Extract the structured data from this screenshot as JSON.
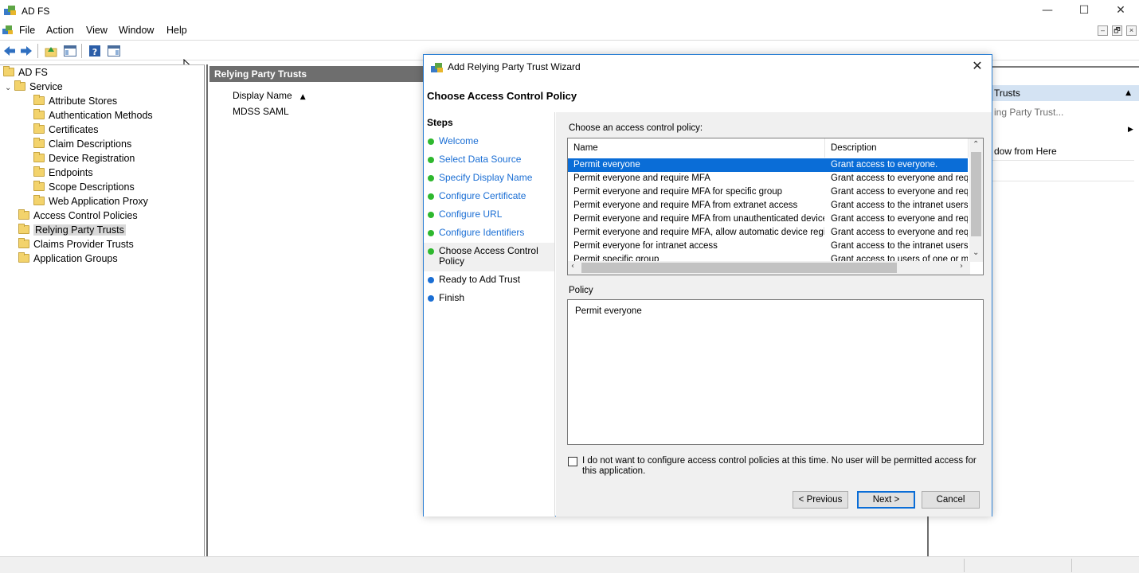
{
  "window": {
    "title": "AD FS",
    "controls": {
      "minimize": "—",
      "maximize": "☐",
      "close": "✕"
    }
  },
  "menubar": {
    "items": [
      "File",
      "Action",
      "View",
      "Window",
      "Help"
    ],
    "mdi": {
      "minimize": "–",
      "restore": "🗗",
      "close": "×"
    }
  },
  "tree": {
    "root": "AD FS",
    "service": "Service",
    "service_children": [
      "Attribute Stores",
      "Authentication Methods",
      "Certificates",
      "Claim Descriptions",
      "Device Registration",
      "Endpoints",
      "Scope Descriptions",
      "Web Application Proxy"
    ],
    "top_items": [
      "Access Control Policies",
      "Relying Party Trusts",
      "Claims Provider Trusts",
      "Application Groups"
    ],
    "selected": "Relying Party Trusts"
  },
  "center": {
    "header": "Relying Party Trusts",
    "column": "Display Name",
    "sort_indicator": "▲",
    "rows": [
      "MDSS SAML"
    ]
  },
  "actions": {
    "header": "Trusts",
    "collapse": "▲",
    "items": [
      "ing Party Trust...",
      "dow from Here"
    ],
    "submenu_arrow": "▶"
  },
  "wizard": {
    "title": "Add Relying Party Trust Wizard",
    "close": "✕",
    "heading": "Choose Access Control Policy",
    "steps_label": "Steps",
    "steps": [
      {
        "label": "Welcome",
        "state": "done"
      },
      {
        "label": "Select Data Source",
        "state": "done"
      },
      {
        "label": "Specify Display Name",
        "state": "done"
      },
      {
        "label": "Configure Certificate",
        "state": "done"
      },
      {
        "label": "Configure URL",
        "state": "done"
      },
      {
        "label": "Configure Identifiers",
        "state": "done"
      },
      {
        "label": "Choose Access Control Policy",
        "state": "current"
      },
      {
        "label": "Ready to Add Trust",
        "state": "pending"
      },
      {
        "label": "Finish",
        "state": "pending"
      }
    ],
    "prompt": "Choose an access control policy:",
    "list_headers": {
      "name": "Name",
      "description": "Description"
    },
    "policies": [
      {
        "name": "Permit everyone",
        "description": "Grant access to everyone."
      },
      {
        "name": "Permit everyone and require MFA",
        "description": "Grant access to everyone and requir"
      },
      {
        "name": "Permit everyone and require MFA for specific group",
        "description": "Grant access to everyone and requir"
      },
      {
        "name": "Permit everyone and require MFA from extranet access",
        "description": "Grant access to the intranet users ar"
      },
      {
        "name": "Permit everyone and require MFA from unauthenticated devices",
        "description": "Grant access to everyone and requir"
      },
      {
        "name": "Permit everyone and require MFA, allow automatic device registr...",
        "description": "Grant access to everyone and requir"
      },
      {
        "name": "Permit everyone for intranet access",
        "description": "Grant access to the intranet users."
      },
      {
        "name": "Permit specific group",
        "description": "Grant access to users of one or more"
      }
    ],
    "selected_policy": "Permit everyone",
    "policy_label": "Policy",
    "policy_text": "Permit everyone",
    "optout_label": "I do not want to configure access control policies at this time. No user will be permitted access for this application.",
    "optout_checked": false,
    "buttons": {
      "previous": "< Previous",
      "next": "Next >",
      "cancel": "Cancel"
    }
  },
  "colors": {
    "selection": "#0a6dd7",
    "step_done_dot": "#2eb82e",
    "step_pending_dot": "#1a6ed4",
    "link_blue": "#1a6ed4",
    "pane_header": "#6e6e6e",
    "actions_header": "#d4e3f3"
  }
}
